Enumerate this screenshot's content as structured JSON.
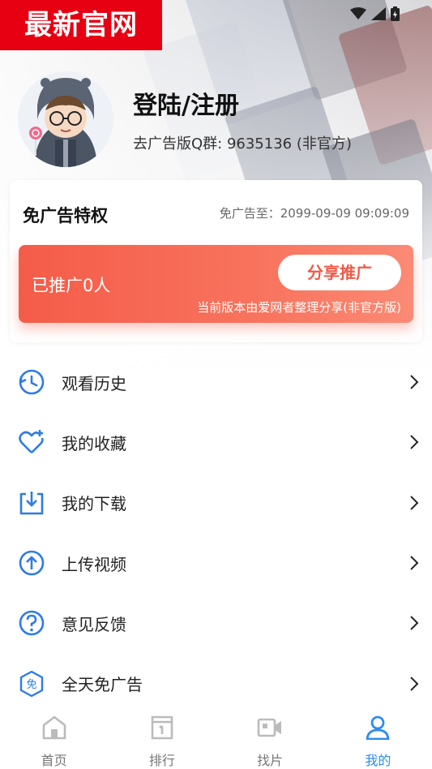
{
  "watermark": "最新官网",
  "profile": {
    "login_label": "登陆/注册",
    "qq_group": "去广告版Q群: 9635136 (非官方)"
  },
  "ad_card": {
    "title": "免广告特权",
    "expire_text": "免广告至：2099-09-09 09:09:09",
    "promo_count": "已推广0人",
    "share_button": "分享推广",
    "note": "当前版本由爱网者整理分享(非官方版)"
  },
  "menu": [
    {
      "label": "观看历史",
      "icon": "history-icon"
    },
    {
      "label": "我的收藏",
      "icon": "heart-plus-icon"
    },
    {
      "label": "我的下载",
      "icon": "download-icon"
    },
    {
      "label": "上传视频",
      "icon": "upload-icon"
    },
    {
      "label": "意见反馈",
      "icon": "question-icon"
    },
    {
      "label": "全天免广告",
      "icon": "no-ads-icon"
    }
  ],
  "tabs": [
    {
      "label": "首页",
      "icon": "home-icon",
      "active": false
    },
    {
      "label": "排行",
      "icon": "ranking-icon",
      "active": false
    },
    {
      "label": "找片",
      "icon": "video-camera-icon",
      "active": false
    },
    {
      "label": "我的",
      "icon": "user-icon",
      "active": true
    }
  ],
  "colors": {
    "accent": "#2d8cf0",
    "promo": "#f45c49",
    "watermark": "#e60012"
  }
}
